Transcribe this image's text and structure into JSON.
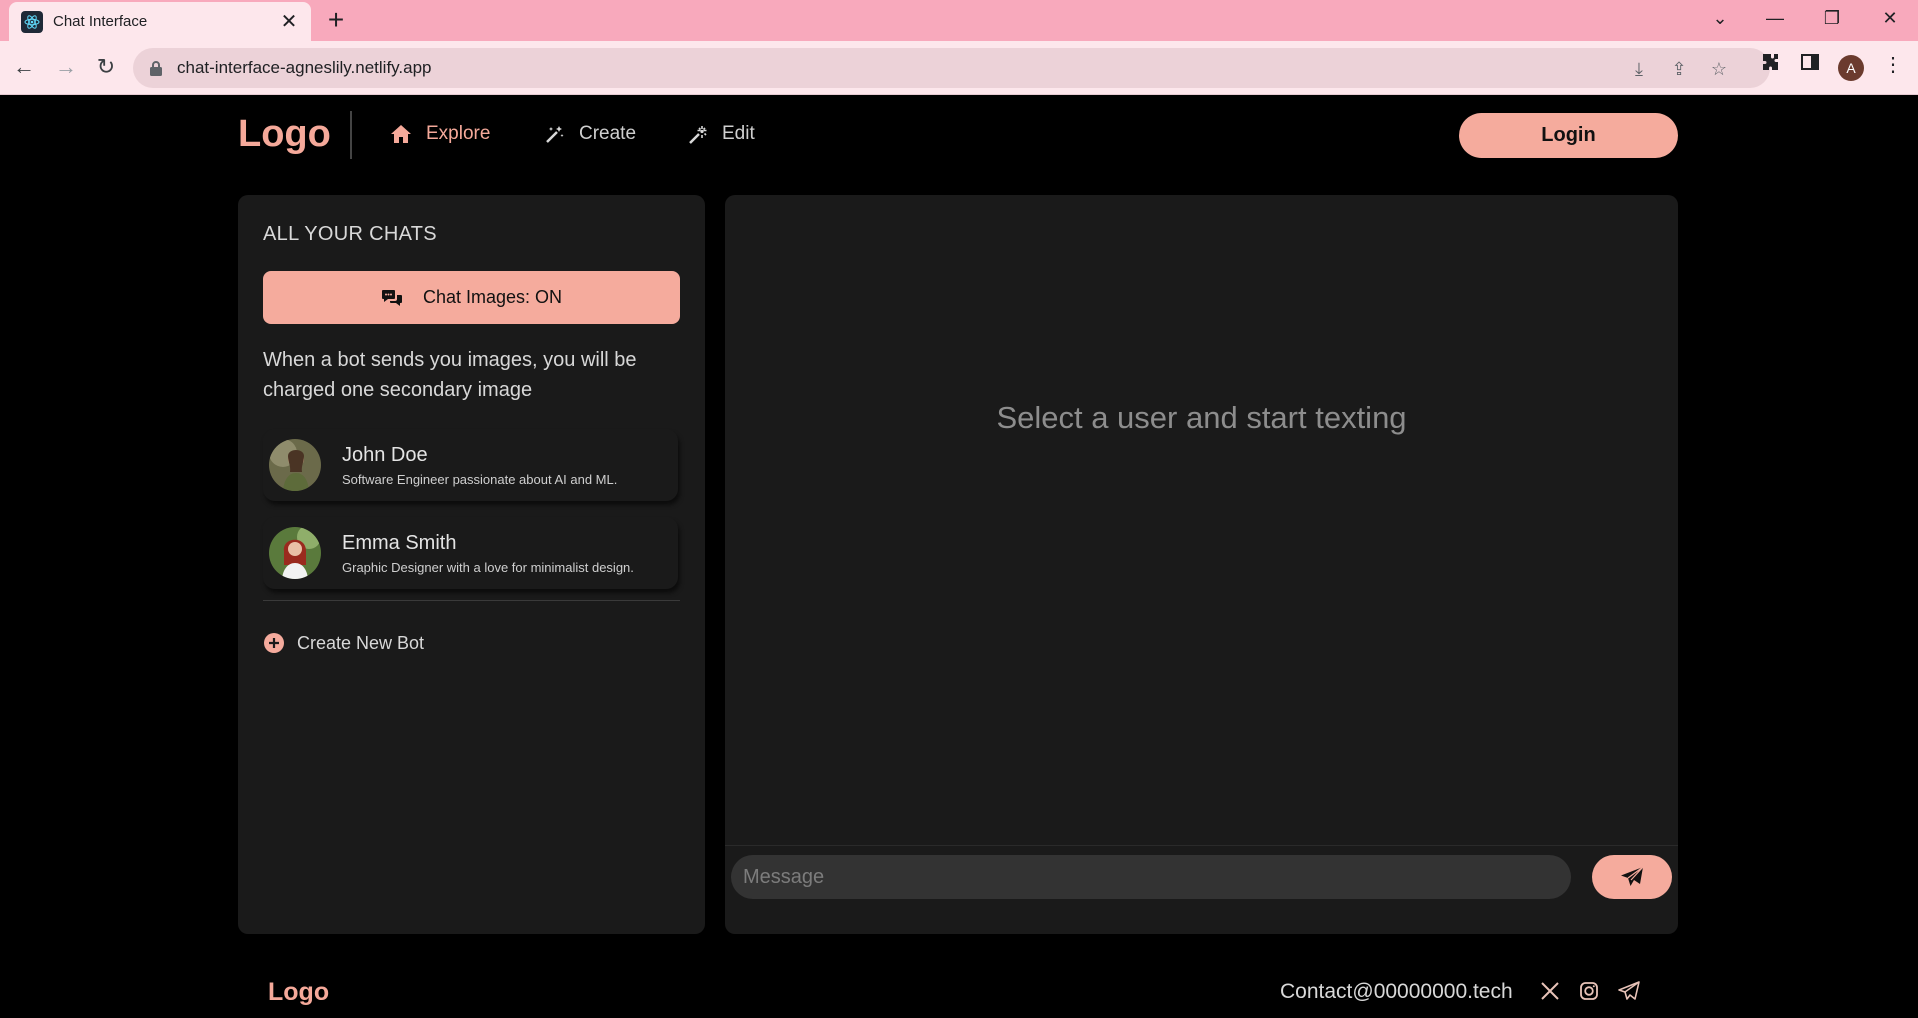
{
  "browser": {
    "tab_title": "Chat Interface",
    "url": "chat-interface-agneslily.netlify.app",
    "profile_initial": "A"
  },
  "header": {
    "logo": "Logo",
    "nav": [
      {
        "label": "Explore",
        "icon": "home-icon",
        "active": true
      },
      {
        "label": "Create",
        "icon": "magic-wand-icon",
        "active": false
      },
      {
        "label": "Edit",
        "icon": "sparkle-wand-icon",
        "active": false
      }
    ],
    "login_label": "Login"
  },
  "sidebar": {
    "heading": "ALL YOUR CHATS",
    "toggle_label": "Chat Images: ON",
    "note": "When a bot sends you images, you will be charged one secondary image",
    "contacts": [
      {
        "name": "John Doe",
        "description": "Software Engineer passionate about AI and ML."
      },
      {
        "name": "Emma Smith",
        "description": "Graphic Designer with a love for minimalist design."
      }
    ],
    "create_label": "Create New Bot"
  },
  "chat": {
    "empty_text": "Select a user and start texting",
    "message_placeholder": "Message"
  },
  "footer": {
    "logo": "Logo",
    "contact": "Contact@00000000.tech",
    "socials": [
      "x-icon",
      "instagram-icon",
      "telegram-icon"
    ]
  },
  "colors": {
    "accent": "#f5ab9d",
    "background": "#000000",
    "panel": "#1a1a1a",
    "tabbar": "#f8a9bc"
  }
}
